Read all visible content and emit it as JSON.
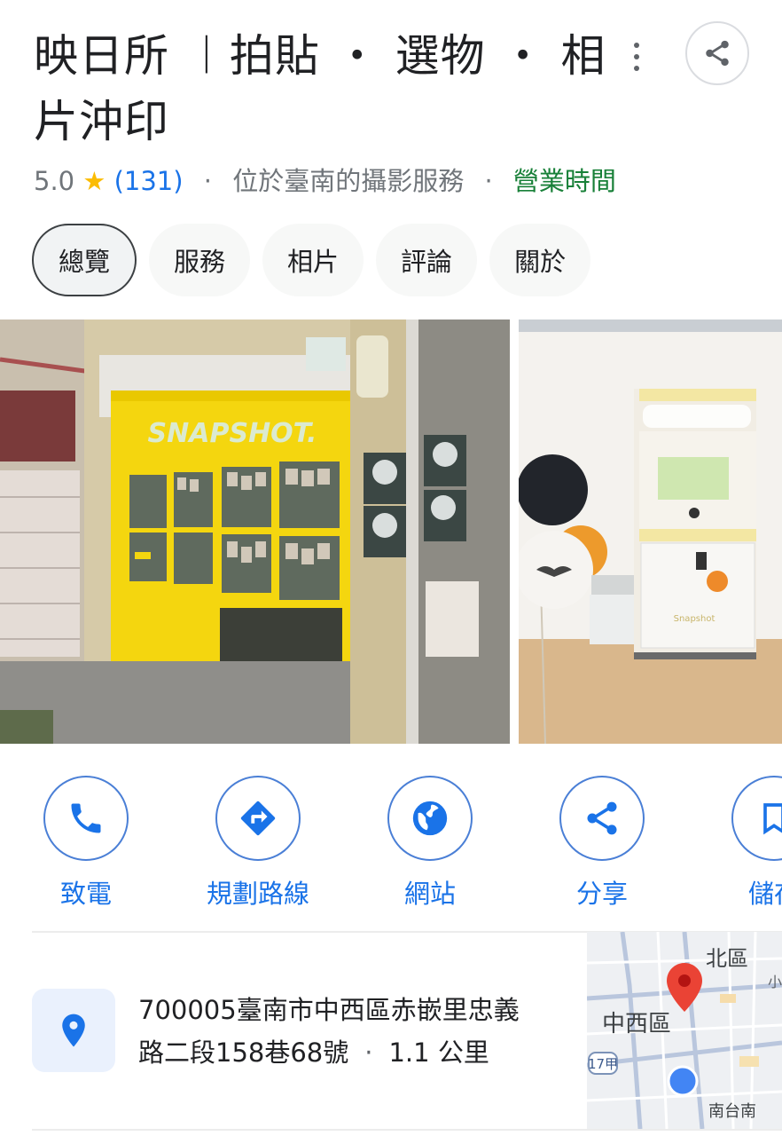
{
  "place": {
    "title": "映日所 ︱拍貼 ・ 選物 ・ 相片沖印",
    "rating": "5.0",
    "star": "★",
    "review_count": "(131)",
    "category": "位於臺南的攝影服務",
    "hours_link": "營業時間",
    "separator": "·"
  },
  "header": {
    "more_icon": "more-vert-icon",
    "share_icon": "share-icon"
  },
  "tabs": [
    {
      "label": "總覽",
      "active": true
    },
    {
      "label": "服務",
      "active": false
    },
    {
      "label": "相片",
      "active": false
    },
    {
      "label": "評論",
      "active": false
    },
    {
      "label": "關於",
      "active": false
    }
  ],
  "photos": {
    "storefront_sign": "SNAPSHOT.",
    "booth_sign": "Snapshot"
  },
  "actions": [
    {
      "label": "致電",
      "icon": "phone-icon"
    },
    {
      "label": "規劃路線",
      "icon": "directions-icon"
    },
    {
      "label": "網站",
      "icon": "globe-icon"
    },
    {
      "label": "分享",
      "icon": "share-icon"
    },
    {
      "label": "儲存",
      "icon": "bookmark-icon"
    }
  ],
  "address": {
    "line1": "700005臺南市中西區赤嵌里忠義",
    "line2": "路二段158巷68號",
    "distance": "1.1 公里",
    "icon": "location-pin-icon"
  },
  "map": {
    "district_north": "北區",
    "district_west": "中西區",
    "road_badge": "17甲",
    "district_south": "南台南",
    "partial_label": "小"
  },
  "colors": {
    "accent": "#1a73e8",
    "open": "#188038",
    "star": "#fbbc04",
    "pin": "#ea4335"
  }
}
